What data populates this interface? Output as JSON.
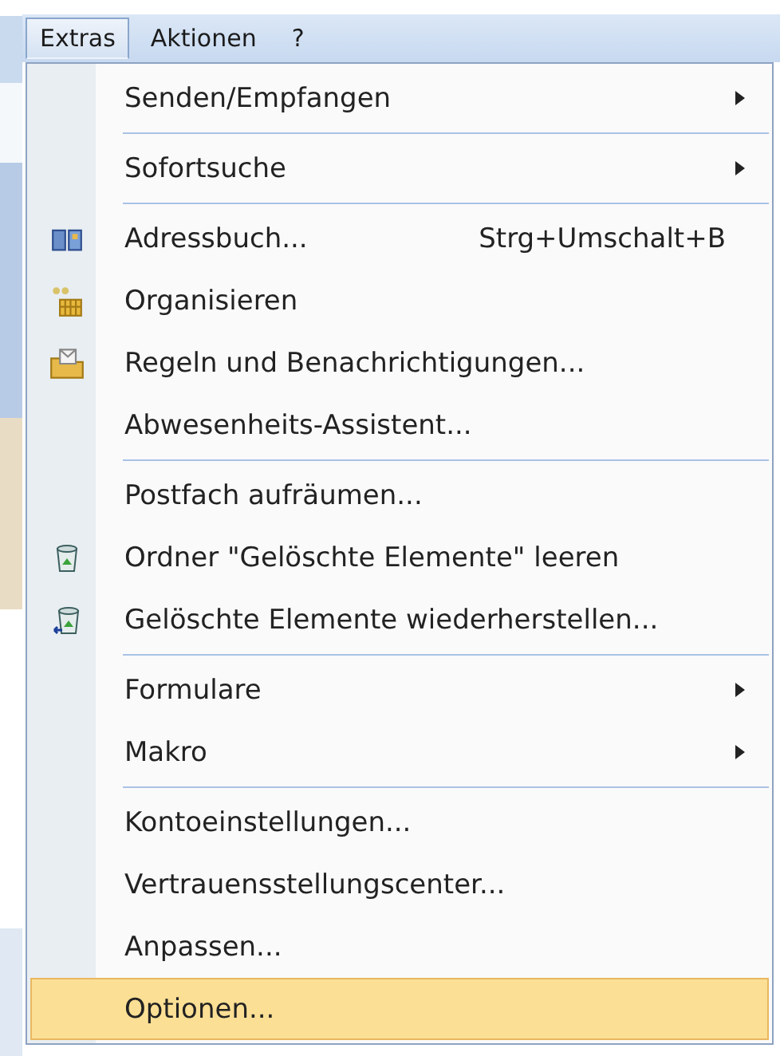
{
  "menubar": [
    {
      "label": "Extras",
      "selected": true
    },
    {
      "label": "Aktionen",
      "selected": false
    },
    {
      "label": "?",
      "selected": false
    }
  ],
  "menu": {
    "items": [
      {
        "kind": "submenu",
        "label": "Senden/Empfangen",
        "selected": false
      },
      {
        "kind": "separator"
      },
      {
        "kind": "submenu",
        "label": "Sofortsuche",
        "selected": false
      },
      {
        "kind": "separator"
      },
      {
        "kind": "book",
        "label": "Adressbuch...",
        "shortcut": "Strg+Umschalt+B",
        "selected": false
      },
      {
        "kind": "organize",
        "label": "Organisieren",
        "selected": false
      },
      {
        "kind": "rules",
        "label": "Regeln und Benachrichtigungen...",
        "selected": false
      },
      {
        "kind": "plain",
        "label": "Abwesenheits-Assistent...",
        "selected": false
      },
      {
        "kind": "separator"
      },
      {
        "kind": "plain",
        "label": "Postfach aufräumen...",
        "selected": false
      },
      {
        "kind": "bin",
        "label": "Ordner \"Gelöschte Elemente\" leeren",
        "selected": false
      },
      {
        "kind": "restore",
        "label": "Gelöschte Elemente wiederherstellen...",
        "selected": false
      },
      {
        "kind": "separator"
      },
      {
        "kind": "submenu",
        "label": "Formulare",
        "selected": false
      },
      {
        "kind": "submenu",
        "label": "Makro",
        "selected": false
      },
      {
        "kind": "separator"
      },
      {
        "kind": "plain",
        "label": "Kontoeinstellungen...",
        "selected": false
      },
      {
        "kind": "plain",
        "label": "Vertrauensstellungscenter...",
        "selected": false
      },
      {
        "kind": "plain",
        "label": "Anpassen...",
        "selected": false
      },
      {
        "kind": "plain",
        "label": "Optionen...",
        "selected": true
      }
    ]
  }
}
